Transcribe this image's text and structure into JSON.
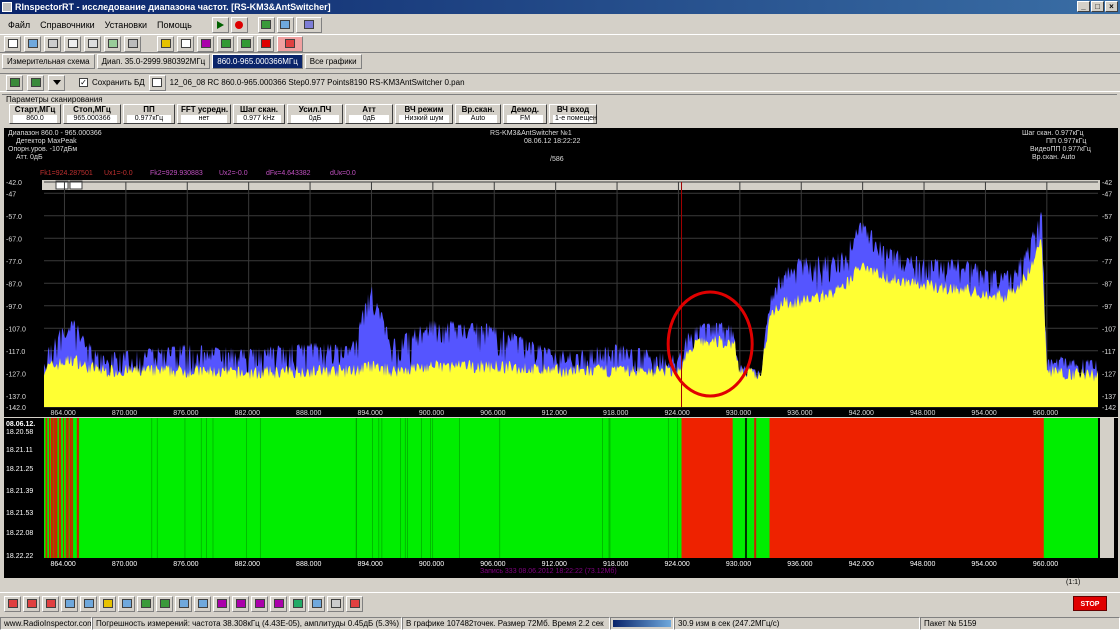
{
  "window": {
    "title": "RInspectorRT - исследование диапазона частот. [RS-KM3&AntSwitcher]"
  },
  "menu": [
    "Файл",
    "Справочники",
    "Установки",
    "Помощь"
  ],
  "tabs": [
    "Измерительная схема",
    "Диап. 35.0-2999.980392МГц",
    "860.0-965.000366МГц",
    "Все графики"
  ],
  "filebar": {
    "save_label": "Сохранить БД",
    "filename": "12_06_08 RC 860.0-965.000366 Step0.977 Points8190 RS-KM3AntSwitcher 0.pan"
  },
  "params": {
    "header": "Параметры сканирования",
    "items": [
      {
        "label": "Старт,МГц",
        "value": "860.0"
      },
      {
        "label": "Стоп,МГц",
        "value": "965.000366"
      },
      {
        "label": "ПП",
        "value": "0.977кГц"
      },
      {
        "label": "FFT усредн.",
        "value": "нет"
      },
      {
        "label": "Шаг скан.",
        "value": "0.977 kHz"
      },
      {
        "label": "Усил.ПЧ",
        "value": "0дБ"
      },
      {
        "label": "Атт",
        "value": "0дБ"
      },
      {
        "label": "ВЧ режим",
        "value": "Низкий шум"
      },
      {
        "label": "Вр.скан.",
        "value": "Auto"
      },
      {
        "label": "Демод.",
        "value": "FM"
      },
      {
        "label": "ВЧ вход",
        "value": "1-е помещен"
      }
    ]
  },
  "spectrum": {
    "info_left": [
      "Диапазон 860.0 - 965.000366",
      "Детектор MaxPeak",
      "Опорн.уров. -107дБм",
      "Атт. 0дБ"
    ],
    "center_title": "RS-KM3&AntSwitcher №1",
    "center_date": "08.06.12 18:22:22",
    "center_sub": "/586",
    "info_right": [
      "Шаг скан. 0.977кГц",
      "ПП 0.977кГц",
      "ВидеоПП 0.977кГц",
      "Вр.скан. Auto"
    ],
    "markers": {
      "fk1": "Fk1=924.287501",
      "ux1": "Ux1=-0.0",
      "fk2": "Fk2=929.930883",
      "ux2": "Ux2=-0.0",
      "df": "dFк=4.643382",
      "dux": "dUк=0.0"
    },
    "y_ticks": [
      "-42.0",
      "-47",
      "-57.0",
      "-67.0",
      "-77.0",
      "-87.0",
      "-97.0",
      "-107.0",
      "-117.0",
      "-127.0",
      "-137.0",
      "-142.0"
    ],
    "y_ticks_right": [
      "-42",
      "-47",
      "-57",
      "-67",
      "-77",
      "-87",
      "-97",
      "-107",
      "-117",
      "-127",
      "-137",
      "-142"
    ],
    "x_ticks": [
      "864.000",
      "870.000",
      "876.000",
      "882.000",
      "888.000",
      "894.000",
      "900.000",
      "906.000",
      "912.000",
      "918.000",
      "924.000",
      "930.000",
      "936.000",
      "942.000",
      "948.000",
      "954.000",
      "960.000"
    ],
    "colors": {
      "peak": "#5555ff",
      "fill": "#ffff33",
      "circle": "#e00000"
    }
  },
  "chart_data": {
    "type": "area",
    "xlim": [
      862.0,
      965.0
    ],
    "ylim": [
      -142,
      -42
    ],
    "x": [
      862,
      864,
      865,
      866,
      868,
      870,
      876,
      882,
      888,
      892,
      894,
      896,
      900,
      906,
      912,
      918,
      924,
      925,
      926,
      928,
      929.5,
      930,
      932,
      933,
      934,
      936,
      940,
      942,
      944,
      948,
      952,
      954,
      956,
      958,
      959.5,
      960,
      962,
      965
    ],
    "series": [
      {
        "values": [
          -125,
          -122,
          -121,
          -124,
          -126,
          -126,
          -126,
          -127,
          -126,
          -126,
          -124,
          -126,
          -124,
          -124,
          -126,
          -126,
          -126,
          -118,
          -113,
          -113,
          -114,
          -126,
          -128,
          -100,
          -96,
          -95,
          -90,
          -78,
          -84,
          -88,
          -90,
          -92,
          -93,
          -84,
          -68,
          -126,
          -127,
          -128
        ]
      },
      {
        "values": [
          -118,
          -104,
          -102,
          -112,
          -118,
          -117,
          -114,
          -116,
          -113,
          -115,
          -87,
          -112,
          -103,
          -105,
          -117,
          -114,
          -119,
          -108,
          -105,
          -104,
          -106,
          -122,
          -126,
          -90,
          -82,
          -75,
          -73,
          -58,
          -70,
          -76,
          -76,
          -80,
          -82,
          -72,
          -53,
          -118,
          -120,
          -121
        ]
      }
    ]
  },
  "waterfall": {
    "times": [
      "08.06.12.",
      "18.20.58",
      "18.21.11",
      "18.21.25",
      "18.21.39",
      "18.21.53",
      "18.22.08",
      "18.22.22"
    ],
    "caption": "Запись 333 08.06.2012 18:22:22 (73.12Мб)",
    "zoom": "(1:1)",
    "colors": {
      "low": "#00ee00",
      "high": "#ee2200"
    }
  },
  "status": {
    "site": "www.RadioInspector.com",
    "error": "Погрешность измерений: частота 38.308кГц (4.43E-05), амплитуды 0.45дБ (5.3%)",
    "points": "В графике 107482точек. Размер 72Мб. Время 2.2 сек",
    "speed": "30.9 изм в сек (247.2МГц/с)",
    "packet": "Пакет № 5159",
    "stop": "STOP"
  }
}
